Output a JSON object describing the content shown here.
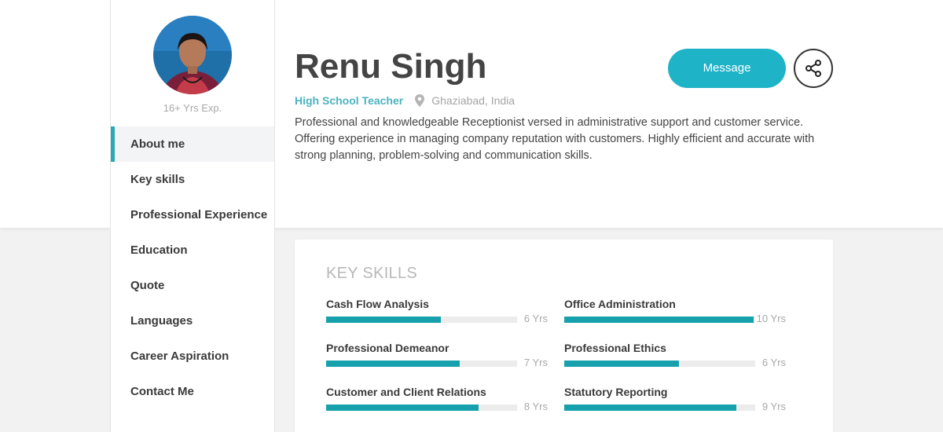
{
  "profile": {
    "name": "Renu Singh",
    "role": "High School Teacher",
    "location": "Ghaziabad, India",
    "experience": "16+ Yrs Exp.",
    "bio": "Professional and knowledgeable Receptionist versed in administrative support and customer service. Offering experience in managing company reputation with customers. Highly efficient and accurate with strong planning, problem-solving and communication skills."
  },
  "actions": {
    "message_label": "Message",
    "share_icon": "share-icon"
  },
  "nav": {
    "items": [
      {
        "label": "About me",
        "active": true
      },
      {
        "label": "Key skills",
        "active": false
      },
      {
        "label": "Professional Experience",
        "active": false
      },
      {
        "label": "Education",
        "active": false
      },
      {
        "label": "Quote",
        "active": false
      },
      {
        "label": "Languages",
        "active": false
      },
      {
        "label": "Career Aspiration",
        "active": false
      },
      {
        "label": "Contact Me",
        "active": false
      }
    ]
  },
  "key_skills": {
    "title": "KEY SKILLS",
    "skills": [
      {
        "name": "Cash Flow Analysis",
        "years": "6 Yrs",
        "level": 0.6
      },
      {
        "name": "Office Administration",
        "years": "10 Yrs",
        "level": 0.99
      },
      {
        "name": "Professional Demeanor",
        "years": "7 Yrs",
        "level": 0.7
      },
      {
        "name": "Professional Ethics",
        "years": "6 Yrs",
        "level": 0.6
      },
      {
        "name": "Customer and Client Relations",
        "years": "8 Yrs",
        "level": 0.8
      },
      {
        "name": "Statutory Reporting",
        "years": "9 Yrs",
        "level": 0.9
      }
    ]
  },
  "colors": {
    "accent": "#1fb3c8",
    "bar_fill": "#17a1ad",
    "role_text": "#4cb3c0"
  }
}
